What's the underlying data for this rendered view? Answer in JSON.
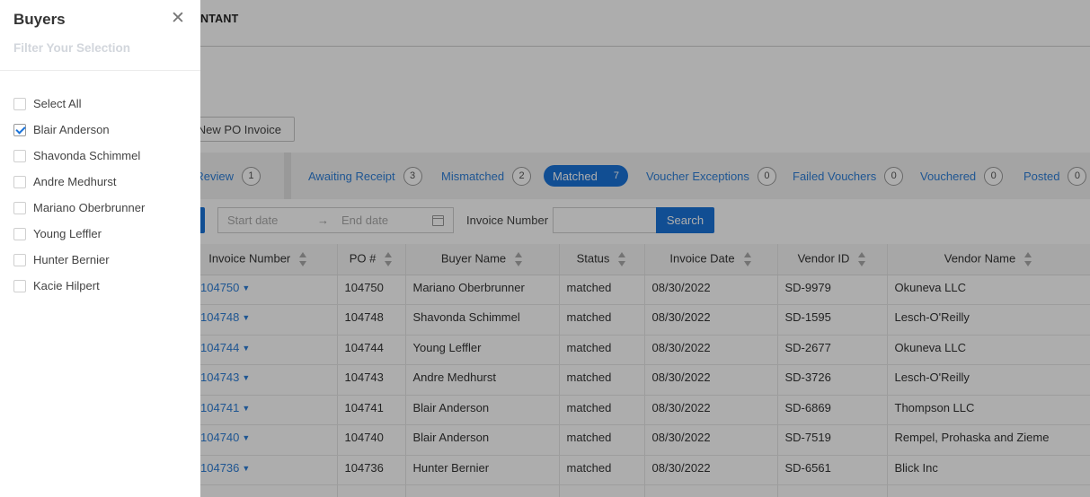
{
  "header": {
    "role_label_partial": "NTANT"
  },
  "actions": {
    "new_po_invoice": "New PO Invoice"
  },
  "tabs": [
    {
      "label": "ds Review",
      "count": "1"
    },
    {
      "label": "Awaiting Receipt",
      "count": "3"
    },
    {
      "label": "Mismatched",
      "count": "2"
    },
    {
      "label": "Matched",
      "count": "7",
      "active": true
    },
    {
      "label": "Voucher Exceptions",
      "count": "0"
    },
    {
      "label": "Failed Vouchers",
      "count": "0"
    },
    {
      "label": "Vouchered",
      "count": "0"
    },
    {
      "label": "Posted",
      "count": "0"
    }
  ],
  "filters": {
    "start_placeholder": "Start date",
    "arrow": "→",
    "end_placeholder": "End date",
    "invoice_number_label": "Invoice Number",
    "invoice_number_value": "",
    "search_label": "Search"
  },
  "table": {
    "columns": [
      "Invoice Number",
      "PO #",
      "Buyer Name",
      "Status",
      "Invoice Date",
      "Vendor ID",
      "Vendor Name"
    ],
    "rows": [
      [
        "104750",
        "104750",
        "Mariano Oberbrunner",
        "matched",
        "08/30/2022",
        "SD-9979",
        "Okuneva LLC"
      ],
      [
        "104748",
        "104748",
        "Shavonda Schimmel",
        "matched",
        "08/30/2022",
        "SD-1595",
        "Lesch-O'Reilly"
      ],
      [
        "104744",
        "104744",
        "Young Leffler",
        "matched",
        "08/30/2022",
        "SD-2677",
        "Okuneva LLC"
      ],
      [
        "104743",
        "104743",
        "Andre Medhurst",
        "matched",
        "08/30/2022",
        "SD-3726",
        "Lesch-O'Reilly"
      ],
      [
        "104741",
        "104741",
        "Blair Anderson",
        "matched",
        "08/30/2022",
        "SD-6869",
        "Thompson LLC"
      ],
      [
        "104740",
        "104740",
        "Blair Anderson",
        "matched",
        "08/30/2022",
        "SD-7519",
        "Rempel, Prohaska and Zieme"
      ],
      [
        "104736",
        "104736",
        "Hunter Bernier",
        "matched",
        "08/30/2022",
        "SD-6561",
        "Blick Inc"
      ],
      [
        "",
        "",
        "",
        "",
        "",
        "",
        ""
      ]
    ]
  },
  "drawer": {
    "title": "Buyers",
    "close_glyph": "✕",
    "subtitle": "Filter Your Selection",
    "options": [
      {
        "label": "Select All",
        "checked": false
      },
      {
        "label": "Blair Anderson",
        "checked": true
      },
      {
        "label": "Shavonda Schimmel",
        "checked": false
      },
      {
        "label": "Andre Medhurst",
        "checked": false
      },
      {
        "label": "Mariano Oberbrunner",
        "checked": false
      },
      {
        "label": "Young Leffler",
        "checked": false
      },
      {
        "label": "Hunter Bernier",
        "checked": false
      },
      {
        "label": "Kacie Hilpert",
        "checked": false
      }
    ]
  },
  "colors": {
    "accent": "#1a73d9",
    "link": "#2f7fd8",
    "overlay": "rgba(0,0,0,0.32)"
  }
}
